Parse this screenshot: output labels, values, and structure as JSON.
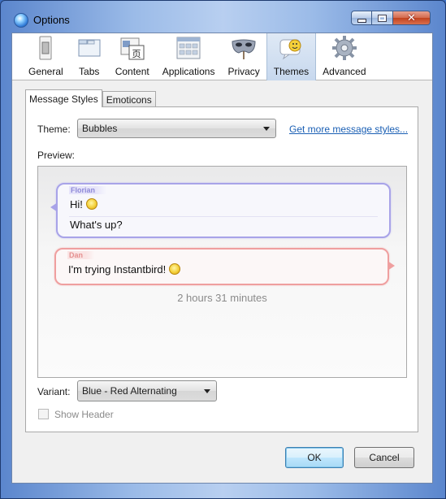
{
  "window": {
    "title": "Options",
    "caption_buttons": {
      "minimize_icon": "minimize-icon",
      "maximize_icon": "maximize-icon",
      "close_icon": "close-icon"
    }
  },
  "toolbar": {
    "items": [
      {
        "label": "General",
        "icon": "general-icon",
        "selected": false
      },
      {
        "label": "Tabs",
        "icon": "tabs-icon",
        "selected": false
      },
      {
        "label": "Content",
        "icon": "content-icon",
        "selected": false
      },
      {
        "label": "Applications",
        "icon": "applications-icon",
        "selected": false
      },
      {
        "label": "Privacy",
        "icon": "privacy-mask-icon",
        "selected": false
      },
      {
        "label": "Themes",
        "icon": "themes-icon",
        "selected": true
      },
      {
        "label": "Advanced",
        "icon": "gear-icon",
        "selected": false
      }
    ]
  },
  "tabs": [
    {
      "label": "Message Styles",
      "active": true
    },
    {
      "label": "Emoticons",
      "active": false
    }
  ],
  "theme": {
    "label": "Theme:",
    "value": "Bubbles",
    "more_link": "Get more message styles..."
  },
  "preview": {
    "label": "Preview:",
    "messages": [
      {
        "sender": "Florian",
        "lines": [
          "Hi!",
          "What's up?"
        ],
        "color": "#a8a3e8"
      },
      {
        "sender": "Dan",
        "lines": [
          "I'm trying Instantbird!"
        ],
        "color": "#ef9f9f"
      }
    ],
    "timestamp": "2 hours 31 minutes"
  },
  "variant": {
    "label": "Variant:",
    "value": "Blue - Red Alternating"
  },
  "show_header": {
    "label": "Show Header",
    "checked": false
  },
  "buttons": {
    "ok": "OK",
    "cancel": "Cancel"
  }
}
